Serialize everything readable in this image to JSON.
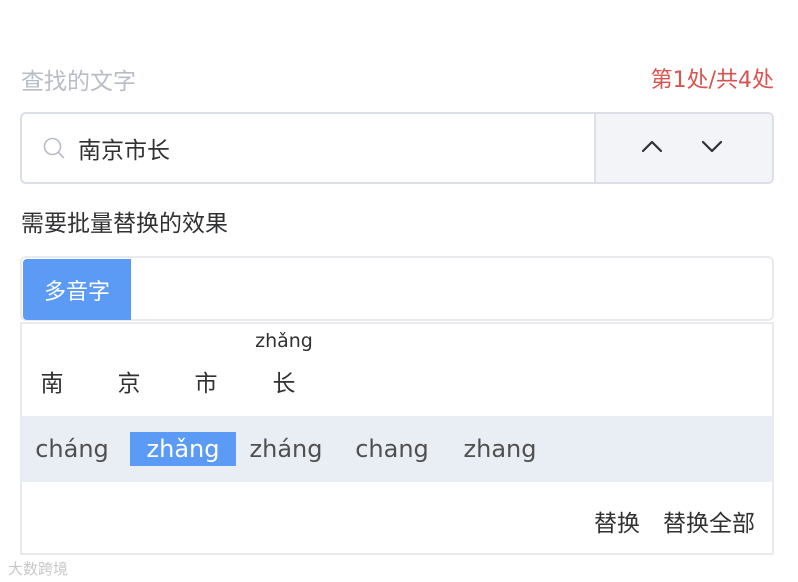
{
  "find": {
    "label": "查找的文字",
    "match_status": "第1处/共4处",
    "query": "南京市长",
    "prev_icon": "chevron-up-icon",
    "next_icon": "chevron-down-icon"
  },
  "replace": {
    "label": "需要批量替换的效果",
    "tabs": [
      {
        "label": "多音字",
        "active": true
      }
    ],
    "characters": [
      {
        "char": "南",
        "pinyin": ""
      },
      {
        "char": "京",
        "pinyin": ""
      },
      {
        "char": "市",
        "pinyin": ""
      },
      {
        "char": "长",
        "pinyin": "zhǎng"
      }
    ],
    "candidates": [
      {
        "label": "cháng",
        "selected": false
      },
      {
        "label": "zhǎng",
        "selected": true
      },
      {
        "label": "zháng",
        "selected": false
      },
      {
        "label": "chang",
        "selected": false
      },
      {
        "label": "zhang",
        "selected": false
      }
    ],
    "actions": {
      "replace_label": "替换",
      "replace_all_label": "替换全部"
    }
  },
  "watermark": "大数跨境",
  "colors": {
    "accent": "#5b9bf5",
    "match_status": "#d9534f"
  }
}
